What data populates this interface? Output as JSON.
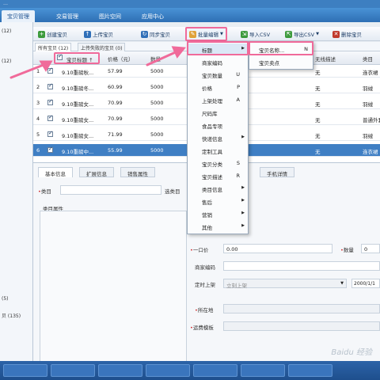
{
  "app": {
    "title": "…"
  },
  "menubar": {
    "tabs": [
      "宝贝管理",
      "交易管理",
      "图片空间",
      "应用中心"
    ]
  },
  "left_panel": {
    "count_top": "(12)",
    "count_mid": "(12)",
    "count_bottom_a": "(5)",
    "count_bottom_b": "贝 (135)"
  },
  "toolbar": {
    "create": "创建宝贝",
    "upload": "上传宝贝",
    "sync": "同步宝贝",
    "batch_edit": "批量编辑",
    "import_csv": "导入CSV",
    "export_csv": "导出CSV",
    "delete": "删除宝贝"
  },
  "subtabs": [
    "所有宝贝 (12)",
    "上传失败的宝贝 (0)"
  ],
  "grid": {
    "headers": {
      "title": "宝贝标题 ↑",
      "price": "价格（元）",
      "qty": "数量",
      "desc": "无线描述",
      "cat": "类目"
    },
    "rows": [
      {
        "n": "1",
        "title": "9.10重磅秋...",
        "price": "57.99",
        "qty": "5000",
        "desc": "无",
        "cat": "连衣裙"
      },
      {
        "n": "2",
        "title": "9.10重磅冬...",
        "price": "60.99",
        "qty": "5000",
        "desc": "无",
        "cat": "羽绒"
      },
      {
        "n": "3",
        "title": "9.10重磅女...",
        "price": "70.99",
        "qty": "5000",
        "desc": "无",
        "cat": "羽绒"
      },
      {
        "n": "4",
        "title": "9.10重磅女...",
        "price": "70.99",
        "qty": "5000",
        "desc": "无",
        "cat": "普通外套"
      },
      {
        "n": "5",
        "title": "9.10重磅女...",
        "price": "71.99",
        "qty": "5000",
        "desc": "无",
        "cat": "羽绒"
      },
      {
        "n": "6",
        "title": "9.10重磅中...",
        "price": "55.99",
        "qty": "5000",
        "desc": "无",
        "cat": "连衣裙"
      }
    ]
  },
  "detail_tabs": [
    "基本信息",
    "扩展信息",
    "销售属性",
    "手机详情"
  ],
  "detail": {
    "category_label": "类目",
    "category_btn": "选类目",
    "cat_attr_label": "类目属性",
    "price_label": "一口价",
    "price_value": "0.00",
    "qty_label": "数量",
    "qty_value": "0",
    "merchant_code_label": "商家编码",
    "schedule_label": "定时上架",
    "schedule_value": "立刻上架",
    "date_value": "2000/1/1",
    "location_label": "所在地",
    "freight_label": "运费模板"
  },
  "batch_menu": {
    "items": [
      {
        "label": "标题",
        "key": "",
        "sub": true
      },
      {
        "label": "商家编码",
        "key": "",
        "sub": false
      },
      {
        "label": "宝贝数量",
        "key": "U",
        "sub": false
      },
      {
        "label": "价格",
        "key": "P",
        "sub": false
      },
      {
        "label": "上架处理",
        "key": "A",
        "sub": false
      },
      {
        "label": "尺码库",
        "key": "",
        "sub": false
      },
      {
        "label": "食品专项",
        "key": "",
        "sub": false
      },
      {
        "label": "快递信息",
        "key": "",
        "sub": true
      },
      {
        "label": "定制工具",
        "key": "",
        "sub": false
      },
      {
        "label": "宝贝分类",
        "key": "S",
        "sub": false
      },
      {
        "label": "宝贝描述",
        "key": "R",
        "sub": false
      },
      {
        "label": "类目信息",
        "key": "",
        "sub": true
      },
      {
        "label": "售后",
        "key": "",
        "sub": true
      },
      {
        "label": "营销",
        "key": "",
        "sub": true
      },
      {
        "label": "其他",
        "key": "",
        "sub": true
      }
    ]
  },
  "title_submenu": {
    "items": [
      {
        "label": "宝贝名称...",
        "key": "N"
      },
      {
        "label": "宝贝卖点",
        "key": ""
      }
    ]
  },
  "watermark": "Baidu 经验",
  "colors": {
    "menubar": "#2e6fb4",
    "selection": "#3f7fc4",
    "highlight_box": "#f06a9a",
    "required_star": "#d03030"
  }
}
